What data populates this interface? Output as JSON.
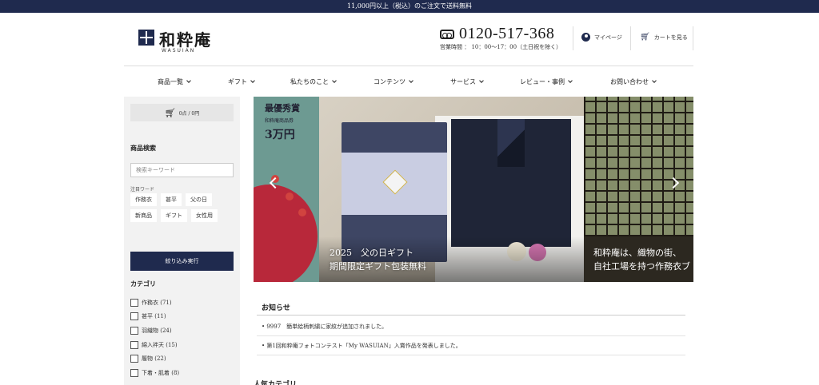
{
  "topbar": {
    "text": "11,000円以上（税込）のご注文で送料無料"
  },
  "header": {
    "logo_text": "和粋庵",
    "logo_sub": "WASUIAN",
    "phone_number": "0120-517-368",
    "phone_hours": "営業時間 ： 10：00～17：00（土日祝を除く）",
    "mypage_label": "マイページ",
    "cart_label": "カートを見る"
  },
  "nav": {
    "items": [
      "商品一覧",
      "ギフト",
      "私たちのこと",
      "コンテンツ",
      "サービス",
      "レビュー・事例",
      "お問い合わせ"
    ]
  },
  "sidebar": {
    "cart_summary": "0点 / 0円",
    "search_heading": "商品検索",
    "search_placeholder": "検索キーワード",
    "keywords_label": "注目ワード",
    "keywords": [
      "作務衣",
      "甚平",
      "父の日",
      "新商品",
      "ギフト",
      "女性用"
    ],
    "submit_label": "絞り込み実行",
    "category_heading": "カテゴリ",
    "categories": [
      {
        "label": "作務衣 (71)"
      },
      {
        "label": "甚平 (11)"
      },
      {
        "label": "羽織物 (24)"
      },
      {
        "label": "綿入袢天 (15)"
      },
      {
        "label": "履物 (22)"
      },
      {
        "label": "下着・肌着 (8)"
      }
    ]
  },
  "slider": {
    "left": {
      "award_title": "最優秀賞",
      "award_sub": "和粋庵商品券",
      "award_value": "3万円"
    },
    "main": {
      "caption_line1": "2025　父の日ギフト",
      "caption_line2": "期間限定ギフト包装無料",
      "knot_text": "和"
    },
    "right": {
      "caption_line1": "和粋庵は、織物の街、",
      "caption_line2": "自社工場を持つ作務衣ブ"
    }
  },
  "news": {
    "title": "お知らせ",
    "items": [
      "• 9997　簡単絵柄刺繍に家紋が追加されました。",
      "• 第1回和粋庵フォトコンテスト「My WASUIAN」入賞作品を発表しました。"
    ]
  },
  "bottom": {
    "heading": "人気カテゴリ"
  },
  "colors": {
    "navy": "#1f2a4e",
    "sidebar_bg": "#f2f2f2"
  }
}
